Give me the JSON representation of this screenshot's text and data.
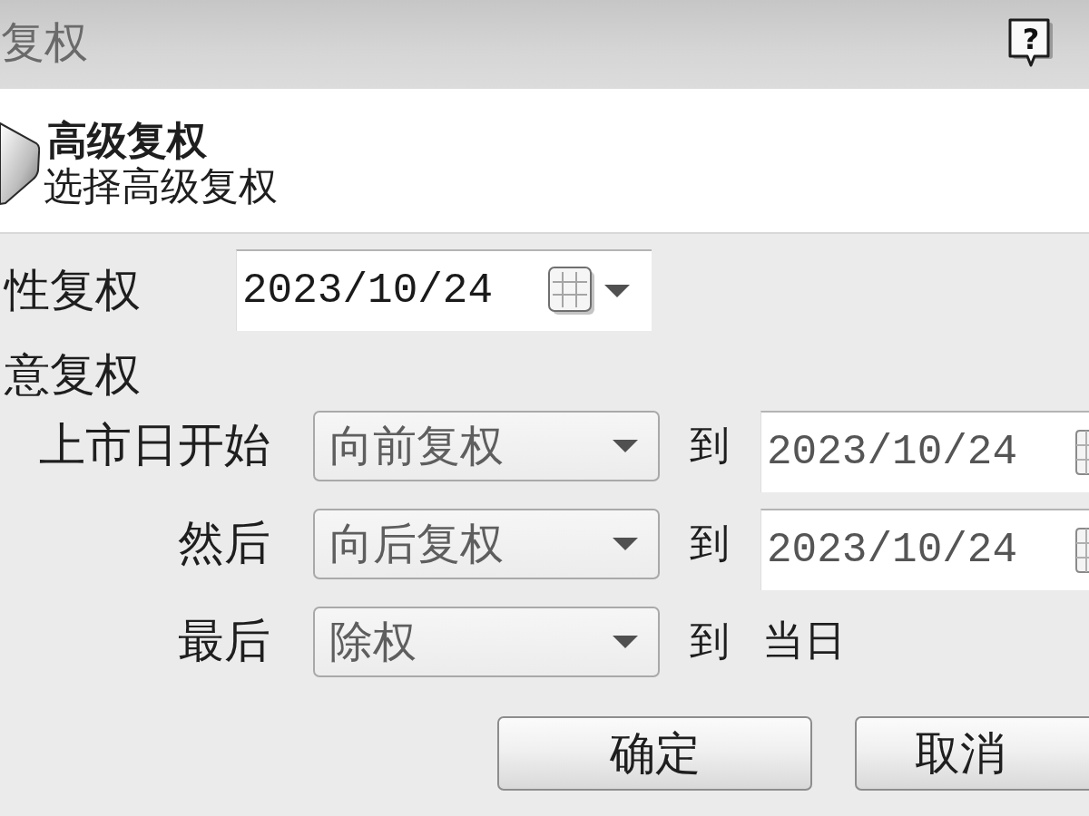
{
  "window": {
    "title": "复权",
    "help_button": "?"
  },
  "header": {
    "title": "高级复权",
    "subtitle": "选择高级复权"
  },
  "options": [
    {
      "kind": "date",
      "label": "性复权",
      "date": {
        "value": "2023/10/24",
        "disabled": false
      }
    },
    {
      "kind": "plain",
      "label": "意复权"
    }
  ],
  "steps": [
    {
      "label": "上市日开始",
      "method": {
        "value": "向前复权",
        "disabled": true
      },
      "to_label": "到",
      "end": {
        "kind": "date",
        "value": "2023/10/24",
        "disabled": true
      }
    },
    {
      "label": "然后",
      "method": {
        "value": "向后复权",
        "disabled": true
      },
      "to_label": "到",
      "end": {
        "kind": "date",
        "value": "2023/10/24",
        "disabled": true
      }
    },
    {
      "label": "最后",
      "method": {
        "value": "除权",
        "disabled": true
      },
      "to_label": "到",
      "end": {
        "kind": "text",
        "value": "当日"
      }
    }
  ],
  "buttons": [
    "确定",
    "取消"
  ]
}
